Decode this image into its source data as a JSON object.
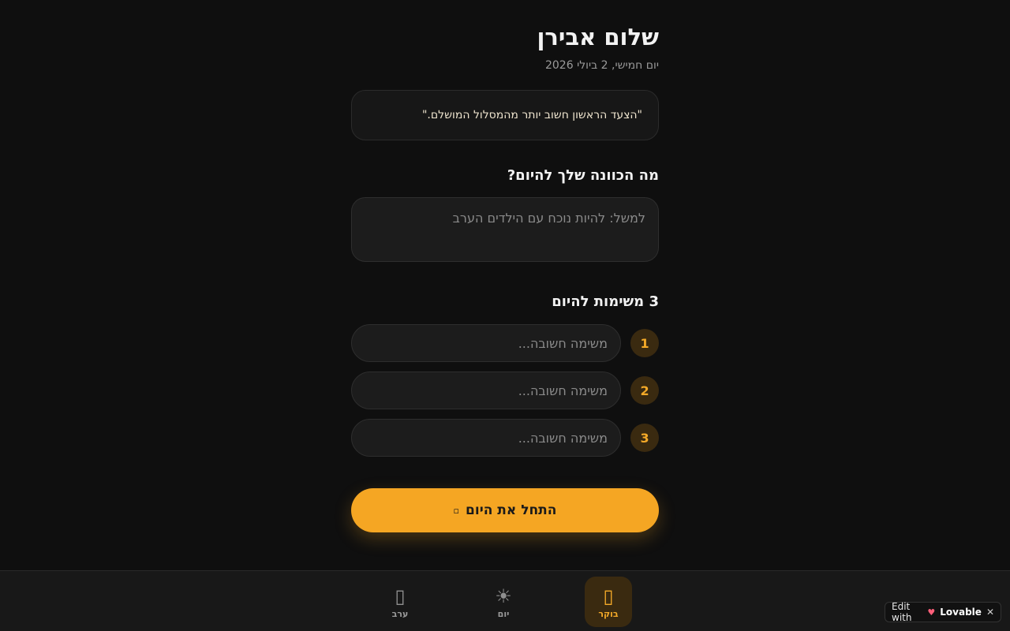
{
  "header": {
    "title": "שלום אבירן",
    "date": "יום חמישי, 2 ביולי 2026"
  },
  "quote": {
    "text": "\"הצעד הראשון חשוב יותר מהמסלול המושלם.\""
  },
  "intention": {
    "title": "מה הכוונה שלך להיום?",
    "placeholder": "למשל: להיות נוכח עם הילדים הערב",
    "value": ""
  },
  "tasks": {
    "title": "3 משימות להיום",
    "items": [
      {
        "number": "1",
        "placeholder": "משימה חשובה..."
      },
      {
        "number": "2",
        "placeholder": "משימה חשובה..."
      },
      {
        "number": "3",
        "placeholder": "משימה חשובה..."
      }
    ]
  },
  "start_button": {
    "label": "התחל את היום",
    "icon": "sparkle-icon"
  },
  "bottom_nav": {
    "items": [
      {
        "label": "בוקר",
        "icon": "sunrise-icon",
        "active": true
      },
      {
        "label": "יום",
        "icon": "sun-icon",
        "active": false
      },
      {
        "label": "ערב",
        "icon": "moon-icon",
        "active": false
      }
    ]
  },
  "badge": {
    "prefix": "Edit with",
    "brand": "Lovable"
  },
  "colors": {
    "background": "#0f0f0f",
    "accent": "#f5a623",
    "card": "#1c1c1c",
    "active_bg": "#3a2a10"
  }
}
